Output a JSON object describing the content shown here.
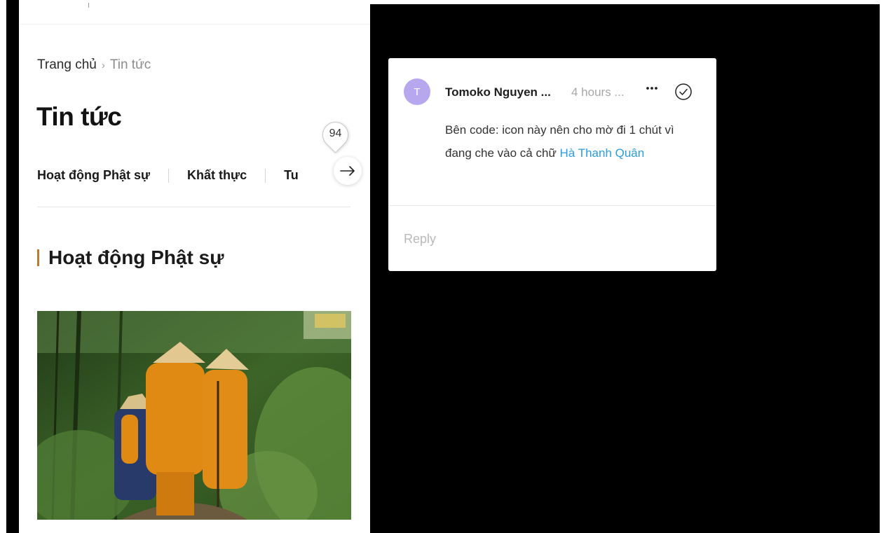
{
  "page": {
    "breadcrumb": {
      "home": "Trang chủ",
      "separator": "›",
      "current": "Tin tức"
    },
    "title": "Tin tức",
    "tabs": [
      {
        "label": "Hoạt động Phật sự"
      },
      {
        "label": "Khất thực"
      },
      {
        "label": "Tu"
      }
    ],
    "section_title": "Hoạt động Phật sự",
    "comment_pin_count": "94",
    "accent_color": "#c07a2a"
  },
  "comment": {
    "avatar_initial": "T",
    "author": "Tomoko Nguyen ...",
    "time": "4 hours ...",
    "body_text": "Bên code: icon này nên cho mờ đi 1 chút vì đang che vào cả chữ ",
    "mention": "Hà Thanh Quân",
    "reply_placeholder": "Reply",
    "avatar_color": "#b7a7ef",
    "mention_color": "#2b9de0"
  },
  "icons": {
    "arrow": "arrow-right-icon",
    "more": "more-horizontal-icon",
    "resolve": "check-circle-icon"
  }
}
